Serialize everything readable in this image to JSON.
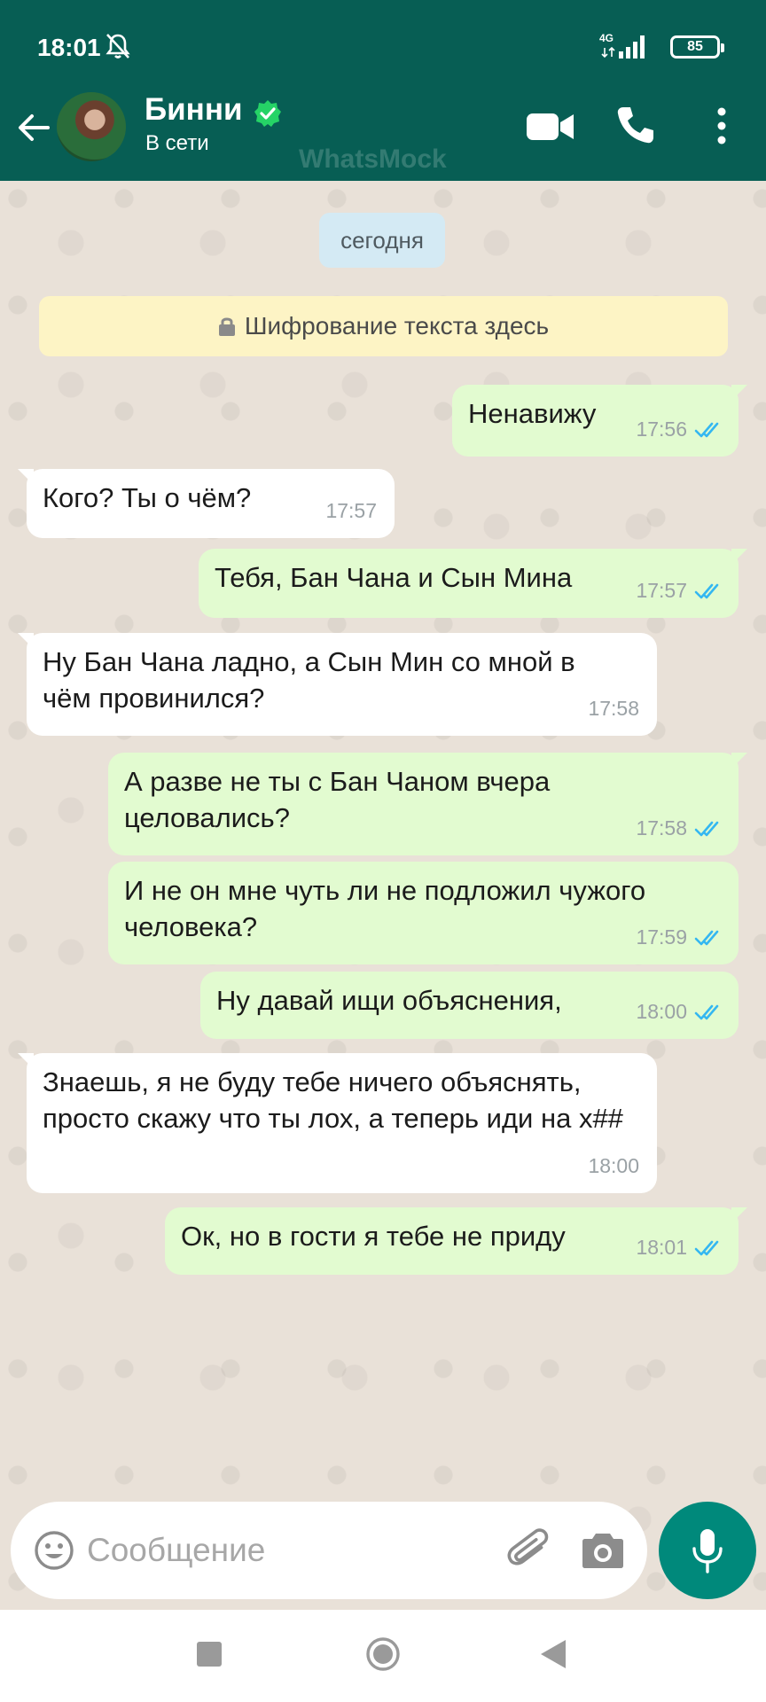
{
  "status_bar": {
    "time": "18:01",
    "network": "4G",
    "battery": "85"
  },
  "header": {
    "contact_name": "Бинни",
    "contact_status": "В сети",
    "watermark": "WhatsMock"
  },
  "chat": {
    "date_chip": "сегодня",
    "encryption_notice": "Шифрование текста здесь",
    "messages": [
      {
        "direction": "out",
        "text": "Ненавижу",
        "time": "17:56",
        "read": true
      },
      {
        "direction": "in",
        "text": "Кого? Ты о чём?",
        "time": "17:57"
      },
      {
        "direction": "out",
        "text": "Тебя, Бан Чана и Сын Мина",
        "time": "17:57",
        "read": true
      },
      {
        "direction": "in",
        "text": "Ну Бан Чана ладно, а Сын Мин со мной в чём провинился?",
        "time": "17:58"
      },
      {
        "direction": "out",
        "text": "А разве не ты с Бан Чаном вчера целовались?",
        "time": "17:58",
        "read": true
      },
      {
        "direction": "out",
        "text": "И не он мне чуть ли не подложил чужого человека?",
        "time": "17:59",
        "read": true
      },
      {
        "direction": "out",
        "text": "Ну давай ищи объяснения,",
        "time": "18:00",
        "read": true
      },
      {
        "direction": "in",
        "text": "Знаешь, я не буду тебе ничего объяснять, просто скажу что ты лох, а теперь иди на х##",
        "time": "18:00"
      },
      {
        "direction": "out",
        "text": "Ок, но в гости я тебе не приду",
        "time": "18:01",
        "read": true
      }
    ]
  },
  "composer": {
    "placeholder": "Сообщение"
  },
  "colors": {
    "header": "#075e54",
    "outgoing_bubble": "#e2fbd0",
    "incoming_bubble": "#ffffff",
    "read_ticks": "#34b7f1",
    "mic_button": "#00897b"
  }
}
